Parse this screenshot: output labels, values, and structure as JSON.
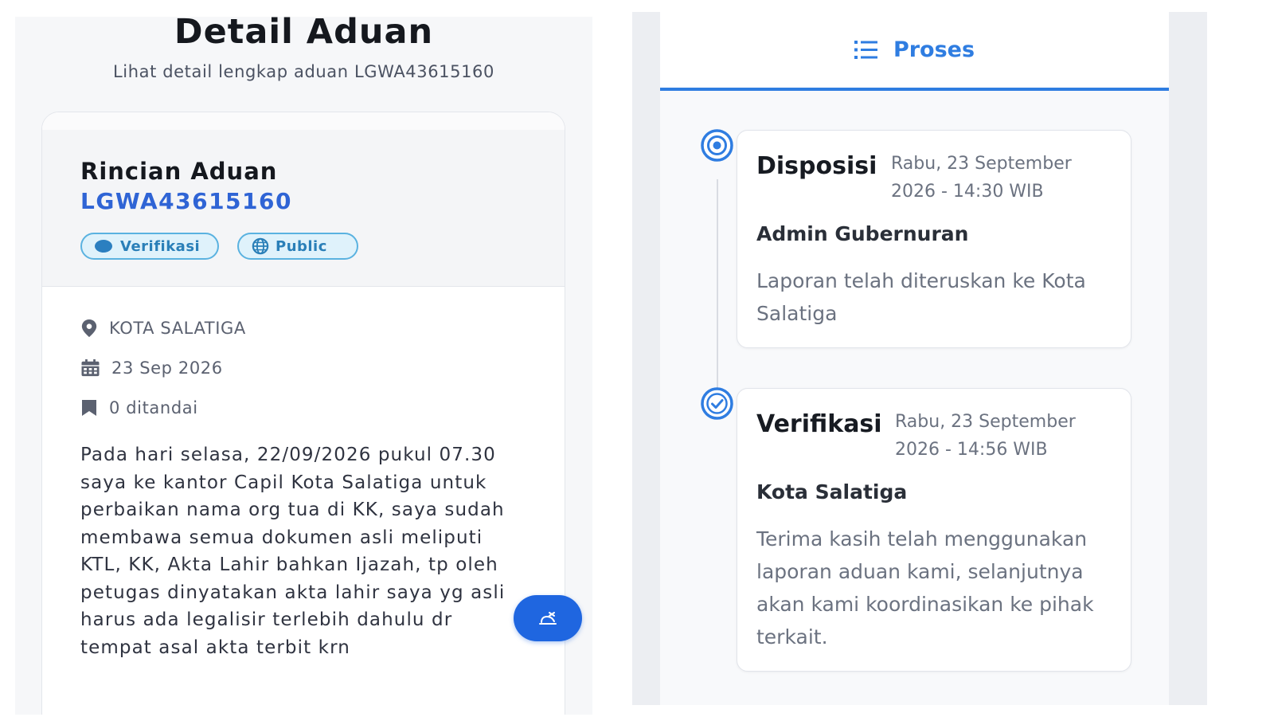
{
  "left": {
    "page_title": "Detail Aduan",
    "page_subtitle": "Lihat detail lengkap aduan LGWA43615160",
    "card": {
      "title": "Rincian Aduan",
      "code": "LGWA43615160",
      "status_badge": "Verifikasi",
      "visibility_badge": "Public",
      "location": "KOTA SALATIGA",
      "date": "23 Sep 2026",
      "bookmarks": "0 ditandai",
      "description": "Pada hari selasa, 22/09/2026 pukul 07.30 saya ke kantor Capil Kota Salatiga untuk perbaikan nama org tua di KK, saya sudah membawa semua dokumen asli meliputi KTL, KK, Akta Lahir bahkan Ijazah, tp oleh petugas dinyatakan akta lahir saya yg asli harus ada legalisir terlebih dahulu dr tempat asal akta terbit krn"
    },
    "fab_icon": "hand-icon"
  },
  "right": {
    "tab_label": "Proses",
    "tab_icon": "list-icon",
    "events": [
      {
        "type": "Disposisi",
        "time": "Rabu, 23 September 2026 - 14:30 WIB",
        "actor": "Admin Gubernuran",
        "text": "Laporan telah diteruskan ke Kota Salatiga",
        "marker_icon": "radio-target-icon"
      },
      {
        "type": "Verifikasi",
        "time": "Rabu, 23 September 2026 - 14:56 WIB",
        "actor": "Kota Salatiga",
        "text": "Terima kasih telah menggunakan laporan aduan kami, selanjutnya akan kami koordinasikan ke pihak terkait.",
        "marker_icon": "check-circle-icon"
      }
    ]
  },
  "colors": {
    "accent": "#2f64d5",
    "tab_accent": "#2f7de1",
    "badge_border": "#5ab2e0",
    "fab": "#1f66e0"
  }
}
